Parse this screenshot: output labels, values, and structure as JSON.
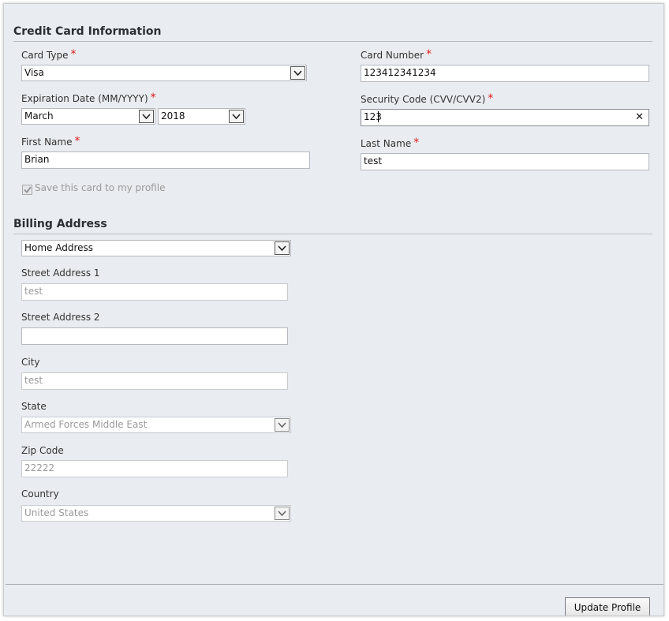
{
  "credit_card": {
    "title": "Credit Card Information",
    "card_type": {
      "label": "Card Type",
      "required_mark": "*",
      "value": "Visa"
    },
    "card_number": {
      "label": "Card Number",
      "required_mark": "*",
      "value": "123412341234"
    },
    "expiration": {
      "label": "Expiration Date (MM/YYYY)",
      "required_mark": "*",
      "month": "March",
      "year": "2018"
    },
    "security_code": {
      "label": "Security Code (CVV/CVV2)",
      "required_mark": "*",
      "value": "123",
      "clear_glyph": "✕"
    },
    "first_name": {
      "label": "First Name",
      "required_mark": "*",
      "value": "Brian"
    },
    "last_name": {
      "label": "Last Name",
      "required_mark": "*",
      "value": "test"
    },
    "save_card": {
      "label": "Save this card to my profile",
      "checked": true
    }
  },
  "billing": {
    "title": "Billing Address",
    "address_select": {
      "value": "Home Address"
    },
    "street1": {
      "label": "Street Address 1",
      "value": "test"
    },
    "street2": {
      "label": "Street Address 2",
      "value": ""
    },
    "city": {
      "label": "City",
      "value": "test"
    },
    "state": {
      "label": "State",
      "value": "Armed Forces Middle East"
    },
    "zip": {
      "label": "Zip Code",
      "value": "22222"
    },
    "country": {
      "label": "Country",
      "value": "United States"
    }
  },
  "footer": {
    "update_button": "Update Profile"
  },
  "colors": {
    "background": "#e9ecf0",
    "required": "#e01b1b",
    "disabled_text": "#9a9a9a"
  }
}
